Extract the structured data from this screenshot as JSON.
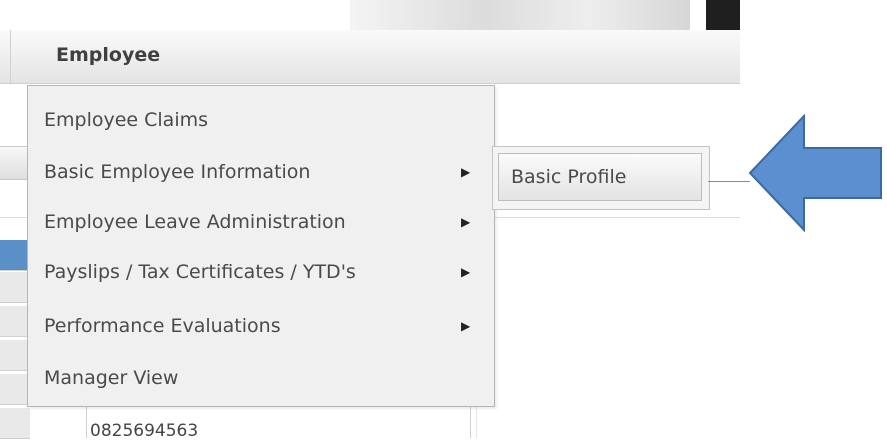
{
  "menubar": {
    "title": "Employee"
  },
  "dropdown": {
    "items": [
      {
        "label": "Employee Claims",
        "has_submenu": false
      },
      {
        "label": "Basic Employee Information",
        "has_submenu": true
      },
      {
        "label": "Employee Leave Administration",
        "has_submenu": true
      },
      {
        "label": "Payslips / Tax Certificates / YTD's",
        "has_submenu": true
      },
      {
        "label": "Performance Evaluations",
        "has_submenu": true
      },
      {
        "label": "Manager View",
        "has_submenu": false
      }
    ]
  },
  "submenu": {
    "items": [
      {
        "label": "Basic Profile"
      }
    ]
  },
  "background": {
    "phone_partial": "0825694563"
  },
  "icons": {
    "submenu_arrow": "triangle-right-icon",
    "callout": "left-arrow-icon"
  },
  "colors": {
    "arrow_fill": "#5b8fcf",
    "arrow_stroke": "#3b6aa3",
    "menu_bg": "#f0f0f0"
  }
}
